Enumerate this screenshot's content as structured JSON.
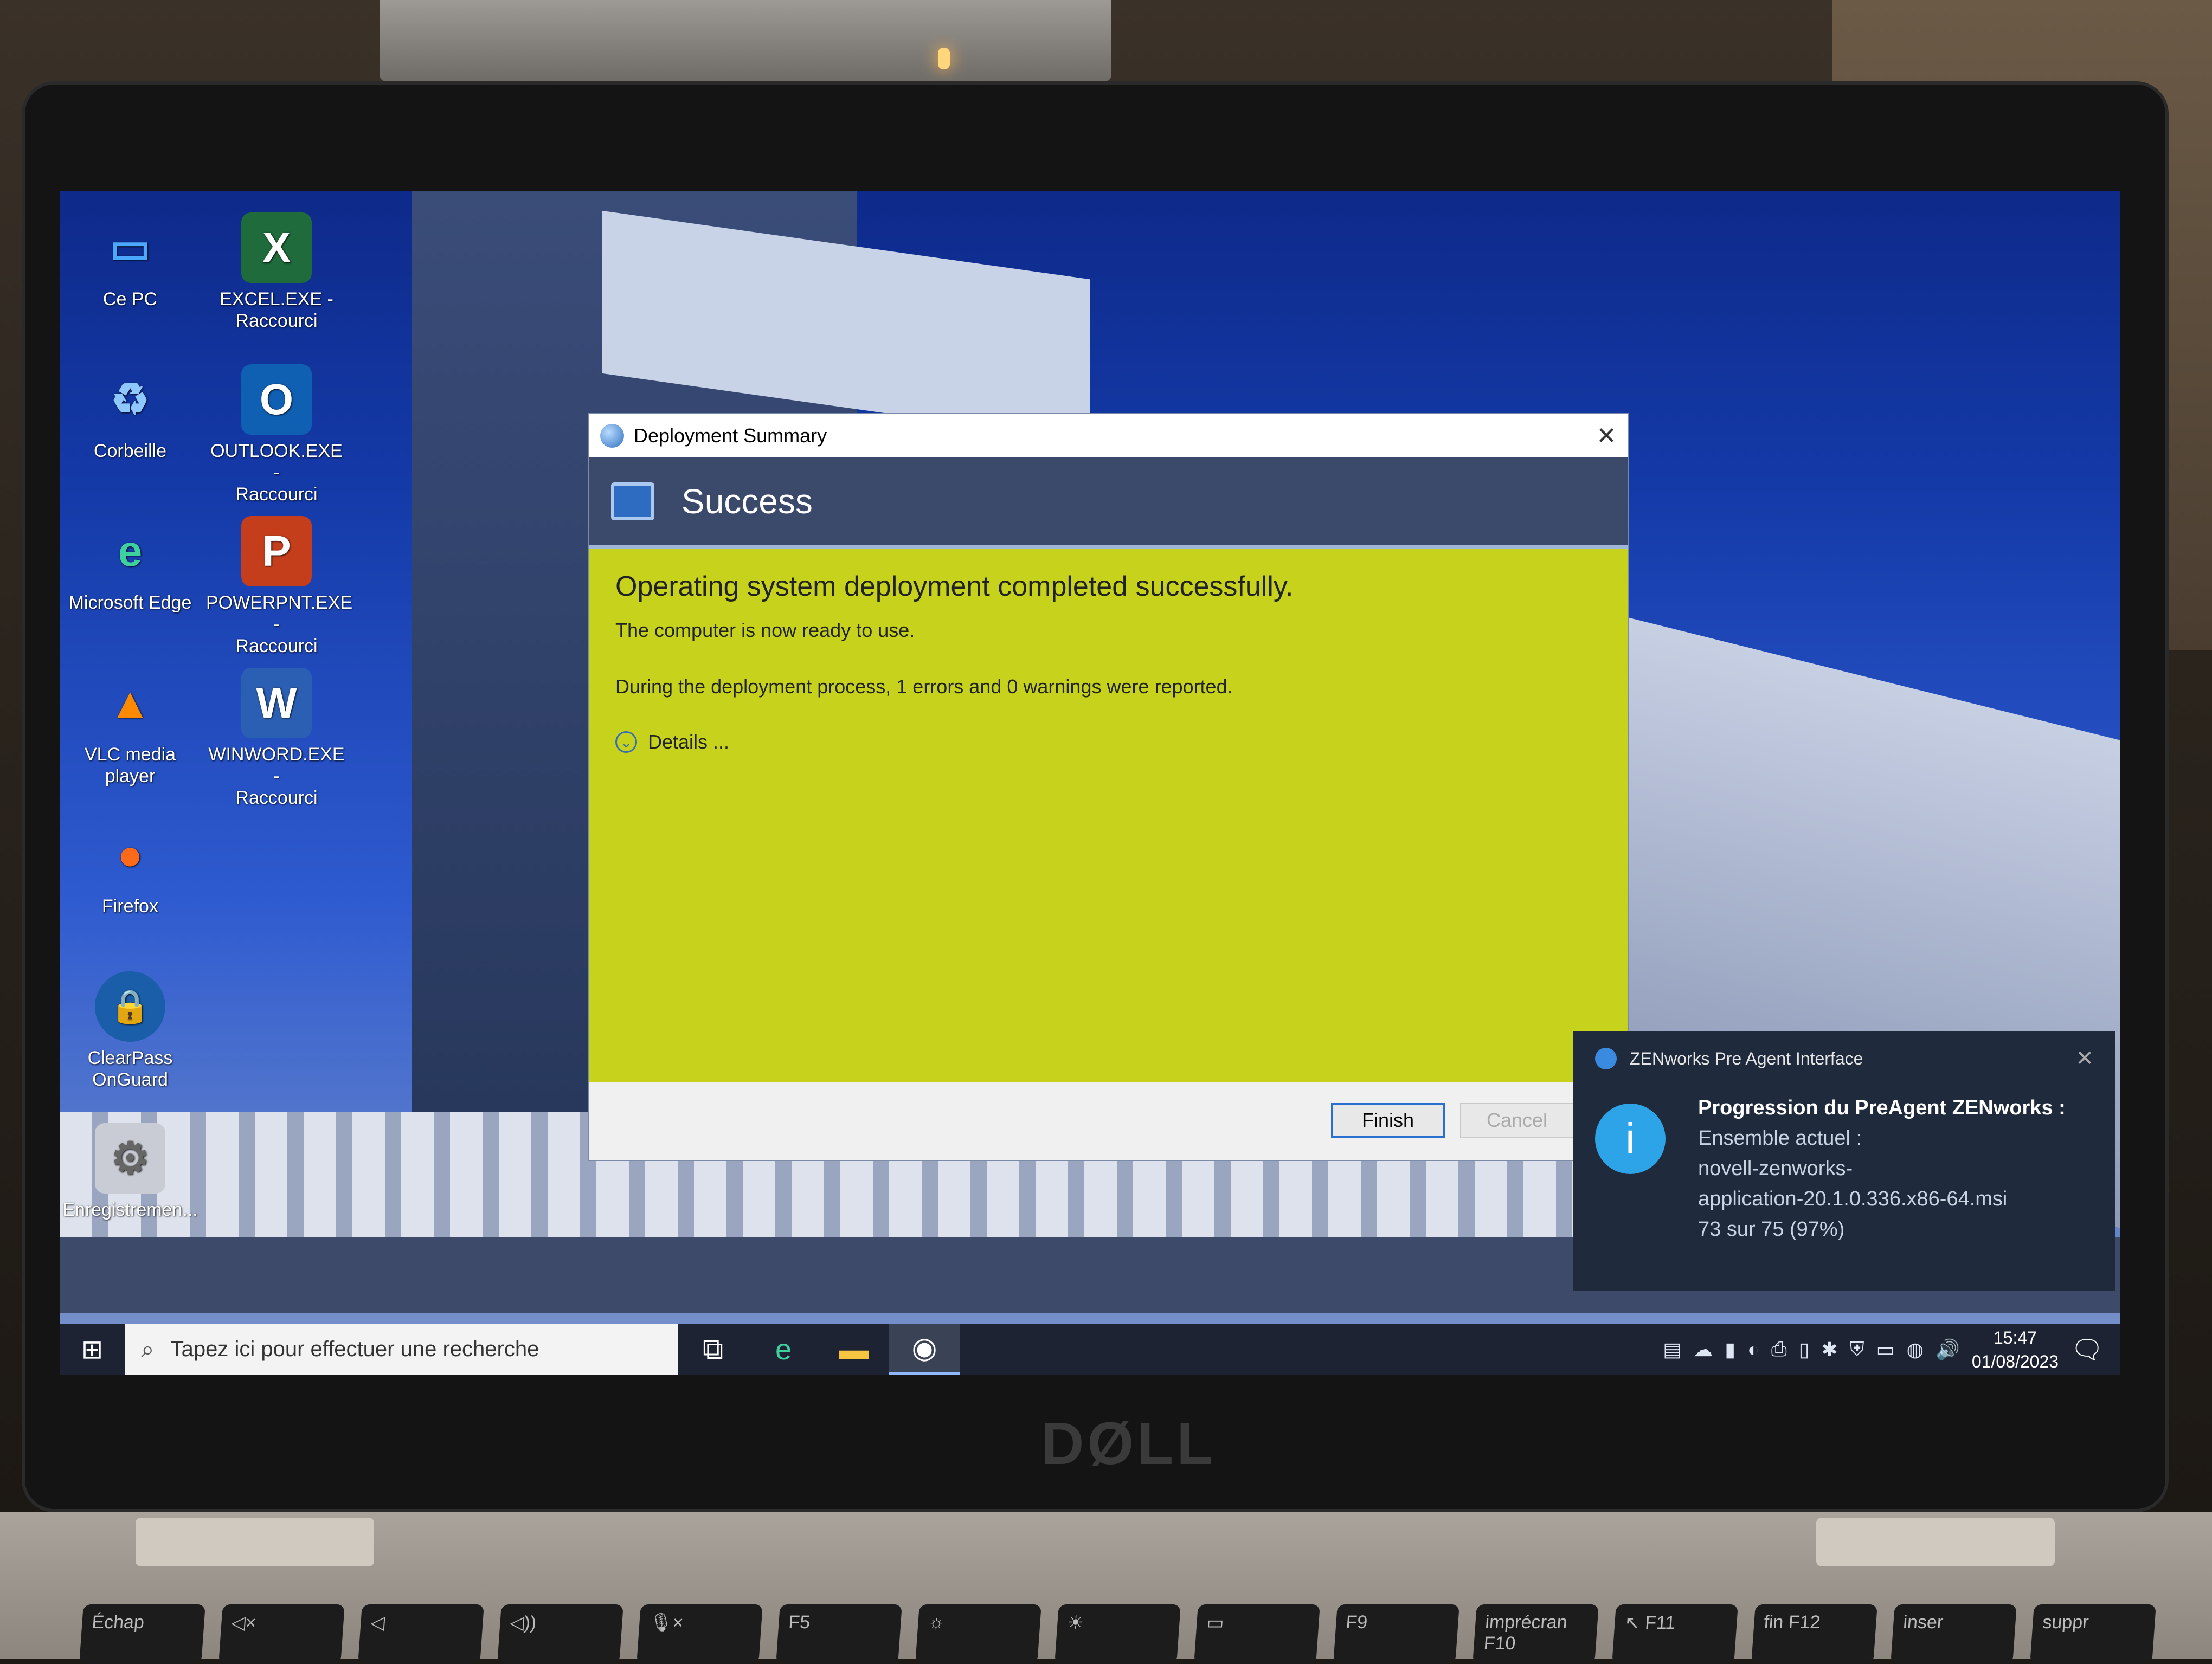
{
  "desktop": {
    "icons": [
      {
        "name": "Ce PC",
        "glyph": "▭"
      },
      {
        "name": "EXCEL.EXE -\nRaccourci",
        "glyph": "X"
      },
      {
        "name": "Corbeille",
        "glyph": "♻"
      },
      {
        "name": "OUTLOOK.EXE -\nRaccourci",
        "glyph": "O"
      },
      {
        "name": "Microsoft Edge",
        "glyph": "e"
      },
      {
        "name": "POWERPNT.EXE -\nRaccourci",
        "glyph": "P"
      },
      {
        "name": "VLC media player",
        "glyph": "▲"
      },
      {
        "name": "WINWORD.EXE -\nRaccourci",
        "glyph": "W"
      },
      {
        "name": "Firefox",
        "glyph": "●"
      },
      {
        "name": "ClearPass\nOnGuard",
        "glyph": "🔒"
      },
      {
        "name": "Enregistremen...",
        "glyph": "⚙"
      }
    ]
  },
  "dialog": {
    "title": "Deployment Summary",
    "close": "✕",
    "header": "Success",
    "message": "Operating system deployment completed successfully.",
    "ready": "The computer is now ready to use.",
    "report": "During the deployment process, 1 errors and 0 warnings were reported.",
    "details": "Details ...",
    "details_icon": "⌄",
    "finish": "Finish",
    "cancel": "Cancel",
    "colors": {
      "body": "#c6d21c",
      "header": "#3b4a6b"
    }
  },
  "toast": {
    "app": "ZENworks Pre Agent Interface",
    "close": "✕",
    "icon": "i",
    "heading": "Progression du PreAgent ZENworks :",
    "line1": "Ensemble actuel :",
    "line2": "novell-zenworks-",
    "line3": "application-20.1.0.336.x86-64.msi",
    "progress": "73 sur 75 (97%)"
  },
  "taskbar": {
    "start": "⊞",
    "search_placeholder": "Tapez ici pour effectuer une recherche",
    "search_icon": "⌕",
    "taskview": "⧉",
    "apps": [
      "e",
      "▬",
      "◉"
    ],
    "tray": [
      "▤",
      "☁",
      "▮",
      "◐",
      "⎙",
      "▯",
      "✱",
      "⛨",
      "▭",
      "◍",
      "🔊"
    ],
    "time": "15:47",
    "date": "01/08/2023",
    "notifications": "🗨"
  },
  "laptop": {
    "brand": "DØLL",
    "keys": [
      "Échap",
      "◁×",
      "◁",
      "◁))",
      "🎙×",
      "F5",
      "☼",
      "☀",
      "▭",
      "F9",
      "imprécran F10",
      "↖ F11",
      "fin F12",
      "inser",
      "suppr"
    ]
  }
}
